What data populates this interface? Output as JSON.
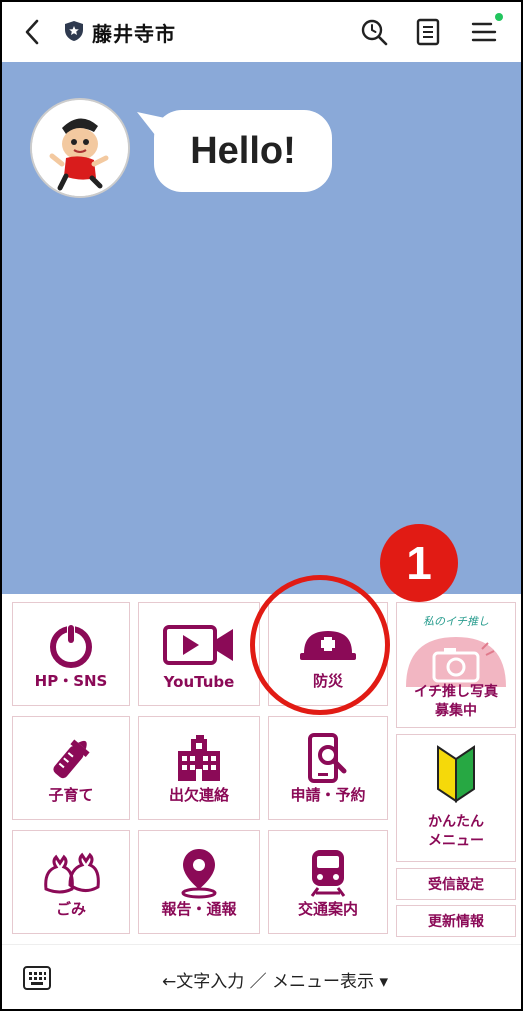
{
  "header": {
    "title": "藤井寺市"
  },
  "chat": {
    "bubble_text": "Hello!"
  },
  "badge_number": "1",
  "menu": {
    "tiles": [
      {
        "label": "HP・SNS",
        "icon": "power-icon"
      },
      {
        "label": "YouTube",
        "icon": "video-icon"
      },
      {
        "label": "防災",
        "icon": "helmet-icon"
      },
      {
        "label": "子育て",
        "icon": "baby-bottle-icon"
      },
      {
        "label": "出欠連絡",
        "icon": "school-icon"
      },
      {
        "label": "申請・予約",
        "icon": "phone-search-icon"
      },
      {
        "label": "ごみ",
        "icon": "garbage-bag-icon"
      },
      {
        "label": "報告・通報",
        "icon": "map-pin-icon"
      },
      {
        "label": "交通案内",
        "icon": "train-icon"
      }
    ],
    "side": {
      "promo_handwriting": "私のイチ推し",
      "promo_label_line1": "イチ推し写真",
      "promo_label_line2": "募集中",
      "beginner_label_line1": "かんたん",
      "beginner_label_line2": "メニュー",
      "settings_label": "受信設定",
      "update_label": "更新情報"
    }
  },
  "footer": {
    "text": "←文字入力 ／ メニュー表示 ▾"
  },
  "colors": {
    "accent": "#8b0a57",
    "chat_bg": "#8aa9d8",
    "highlight": "#e11b14",
    "online_dot": "#22c55e"
  }
}
